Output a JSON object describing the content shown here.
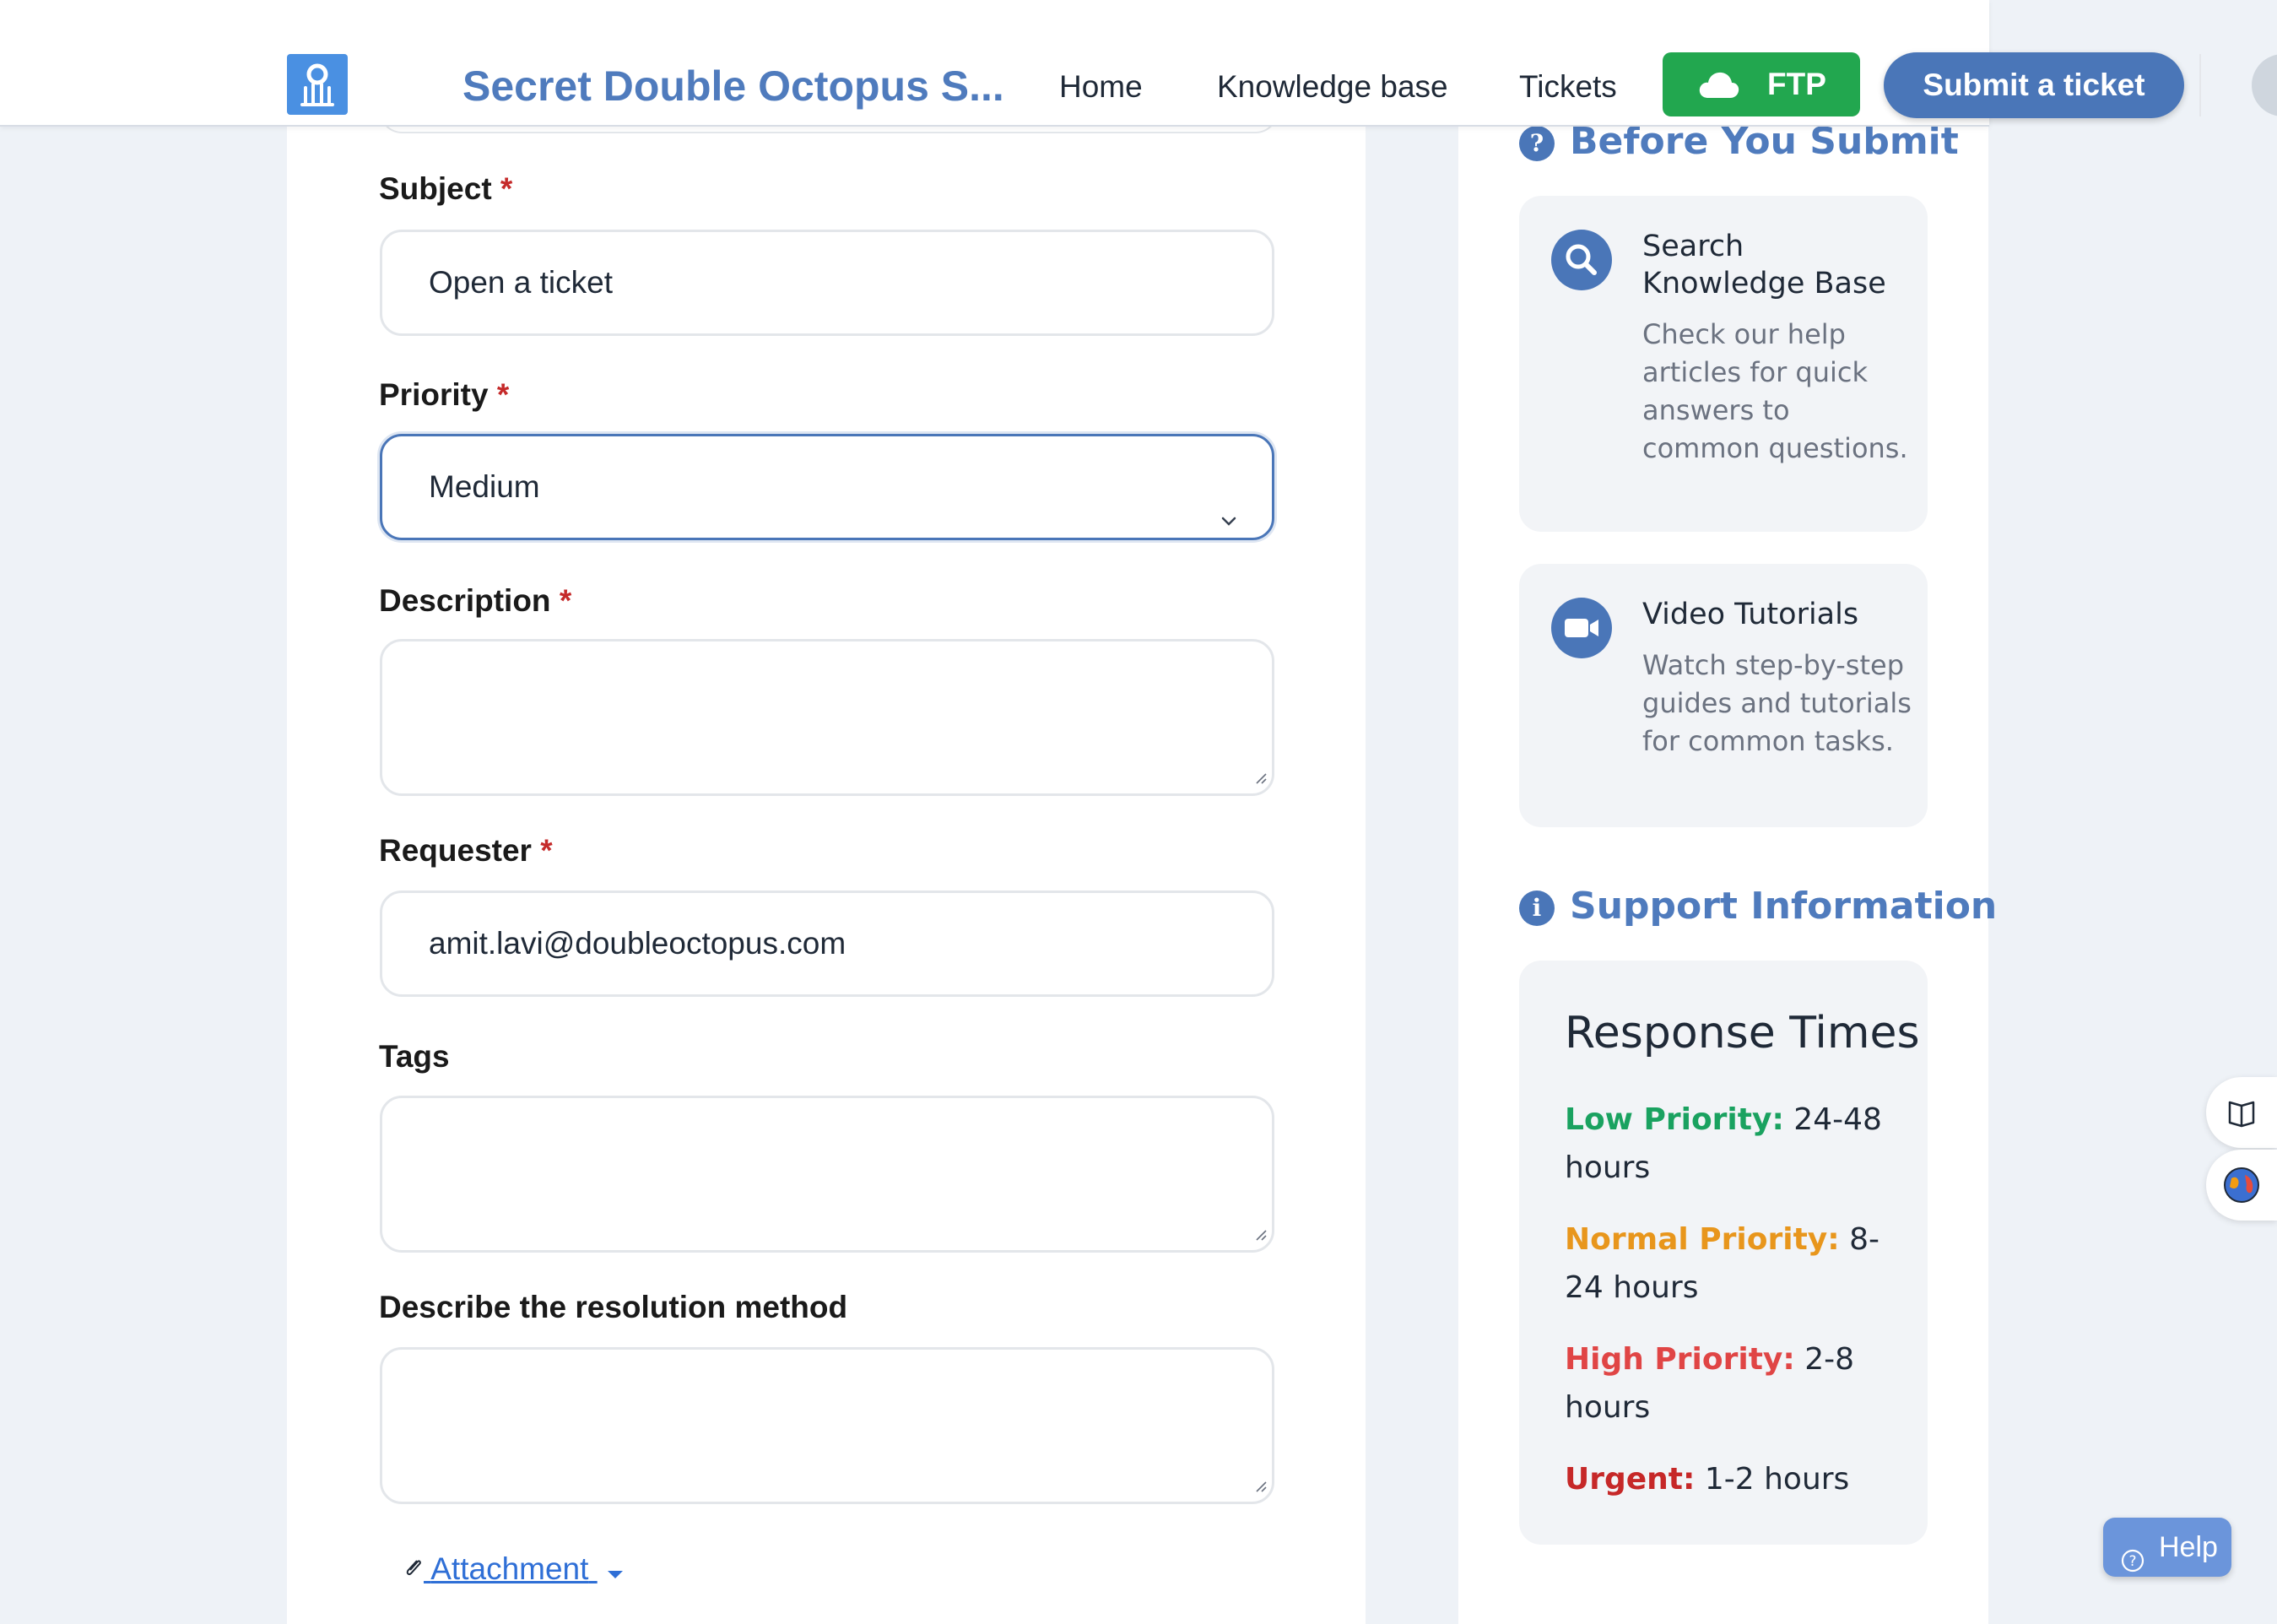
{
  "header": {
    "brand": "Secret Double Octopus S...",
    "nav": {
      "home": "Home",
      "knowledge_base": "Knowledge base",
      "tickets": "Tickets"
    },
    "ftp_label": "FTP",
    "submit_label": "Submit a ticket"
  },
  "form": {
    "subject": {
      "label": "Subject",
      "required": "*",
      "value": "Open a ticket"
    },
    "priority": {
      "label": "Priority",
      "required": "*",
      "value": "Medium"
    },
    "description": {
      "label": "Description",
      "required": "*"
    },
    "requester": {
      "label": "Requester",
      "required": "*",
      "value": "amit.lavi@doubleoctopus.com"
    },
    "tags": {
      "label": "Tags"
    },
    "resolution": {
      "label": "Describe the resolution method"
    },
    "attachment_label": "Attachment"
  },
  "sidebar": {
    "before_title": "Before You Submit",
    "kb": {
      "title": "Search Knowledge Base",
      "text": "Check our help articles for quick answers to common questions."
    },
    "video": {
      "title": "Video Tutorials",
      "text": "Watch step-by-step guides and tutorials for common tasks."
    },
    "support_title": "Support Information",
    "response": {
      "heading": "Response Times",
      "low_label": "Low Priority:",
      "low_value": "24-48 hours",
      "low_color": "#1aa260",
      "normal_label": "Normal Priority:",
      "normal_value": "8-24 hours",
      "normal_color": "#e8961c",
      "high_label": "High Priority:",
      "high_value": "2-8 hours",
      "high_color": "#e04545",
      "urgent_label": "Urgent:",
      "urgent_value": "1-2 hours",
      "urgent_color": "#c62828"
    }
  },
  "help_label": "Help",
  "icons": [
    "octopus-logo-icon",
    "cloud-icon",
    "chevron-down-icon",
    "resize-grip-icon",
    "paperclip-icon",
    "caret-down-icon",
    "question-circle-icon",
    "search-icon",
    "video-camera-icon",
    "info-circle-icon",
    "book-icon",
    "globe-icon",
    "help-circle-icon"
  ]
}
